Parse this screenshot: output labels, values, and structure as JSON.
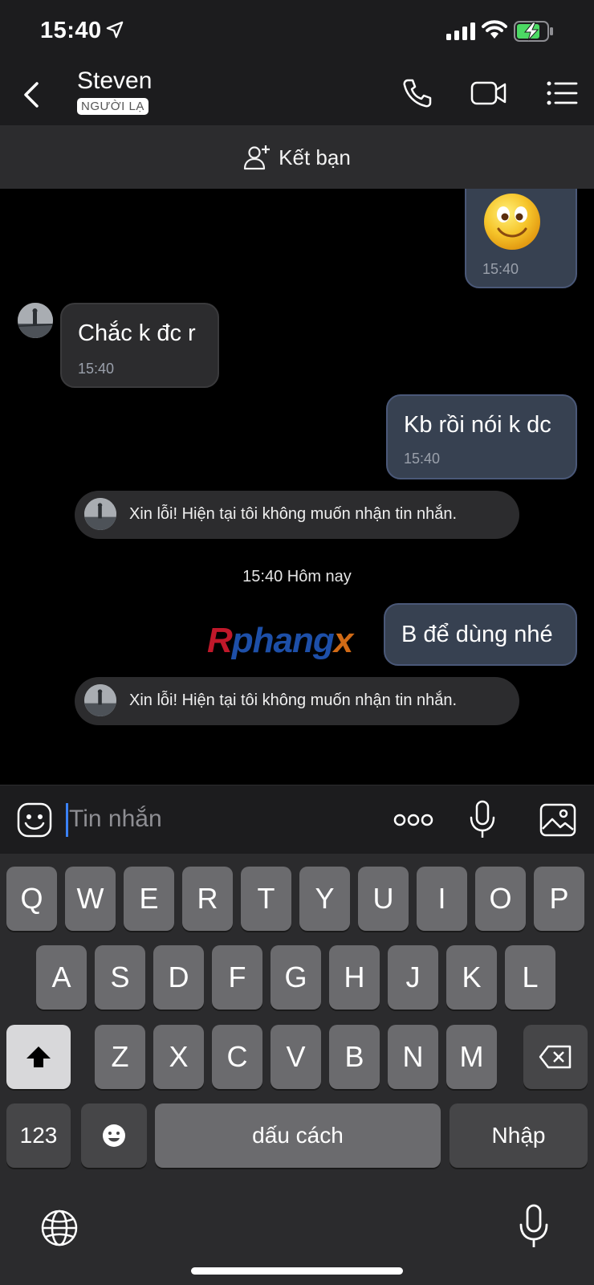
{
  "status": {
    "time": "15:40"
  },
  "header": {
    "name": "Steven",
    "badge": "NGƯỜI LẠ"
  },
  "add_friend": {
    "label": "Kết bạn"
  },
  "messages": [
    {
      "time": "15:40"
    },
    {
      "text": "Chắc k đc r",
      "time": "15:40"
    },
    {
      "text": "Kb rồi nói k dc",
      "time": "15:40"
    },
    {
      "text": "Xin lỗi! Hiện tại tôi không muốn nhận tin nhắn."
    },
    {
      "text": "15:40 Hôm nay"
    },
    {
      "text": "B để dùng nhé"
    },
    {
      "text": "Xin lỗi! Hiện tại tôi không muốn nhận tin nhắn."
    }
  ],
  "watermark": "Rphangx",
  "input": {
    "placeholder": "Tin nhắn"
  },
  "keyboard": {
    "row1": [
      "Q",
      "W",
      "E",
      "R",
      "T",
      "Y",
      "U",
      "I",
      "O",
      "P"
    ],
    "row2": [
      "A",
      "S",
      "D",
      "F",
      "G",
      "H",
      "J",
      "K",
      "L"
    ],
    "row3": [
      "Z",
      "X",
      "C",
      "V",
      "B",
      "N",
      "M"
    ],
    "numbers": "123",
    "space": "dấu cách",
    "enter": "Nhập"
  },
  "colors": {
    "outgoing": "#374151",
    "incoming": "#2c2c2e",
    "accent": "#3b82f6"
  }
}
